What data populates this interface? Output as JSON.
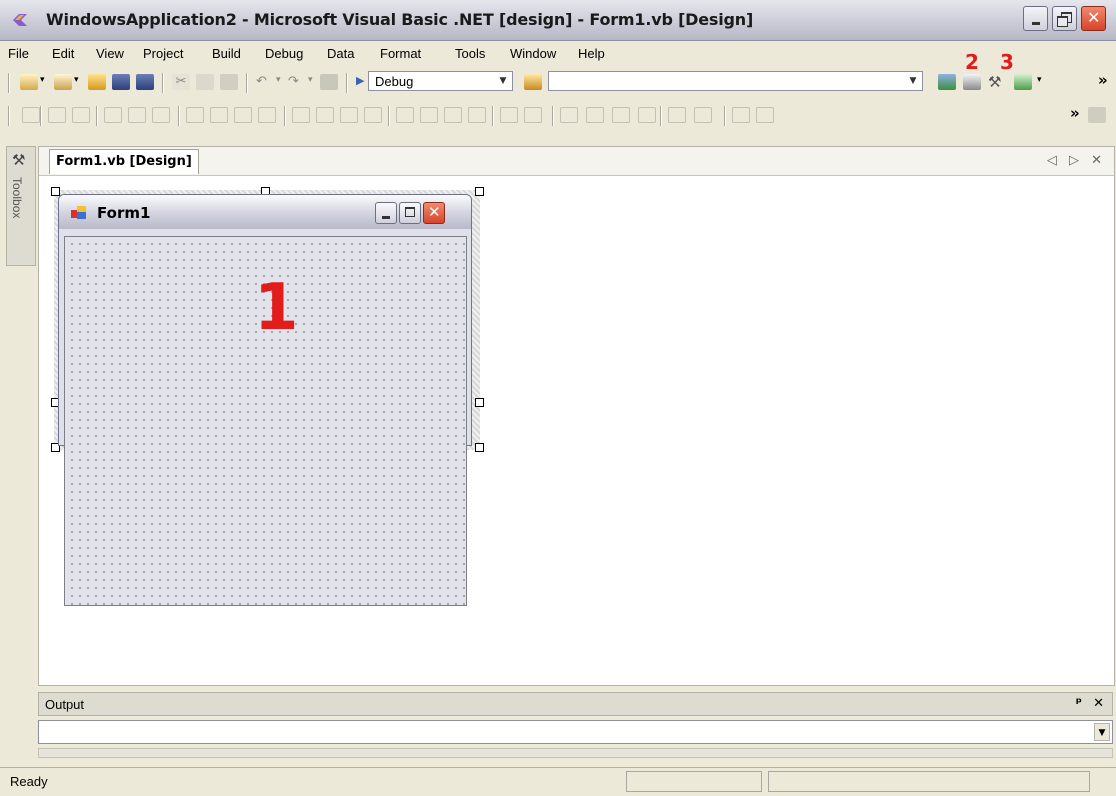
{
  "window": {
    "title": "WindowsApplication2 - Microsoft Visual Basic .NET [design] - Form1.vb [Design]"
  },
  "menu": {
    "items": [
      "File",
      "Edit",
      "View",
      "Project",
      "Build",
      "Debug",
      "Data",
      "Format",
      "Tools",
      "Window",
      "Help"
    ]
  },
  "toolbar": {
    "config_combo": "Debug",
    "overflow_glyph": "»"
  },
  "toolbox": {
    "label": "Toolbox"
  },
  "document": {
    "tab_label": "Form1.vb [Design]",
    "tab_nav": "◁ ▷ ✕"
  },
  "designer": {
    "form_title": "Form1"
  },
  "annotations": {
    "a1": "1",
    "a2": "2",
    "a3": "3"
  },
  "output": {
    "title": "Output",
    "pin": "ᵖ",
    "close": "✕",
    "dropdown": "▼"
  },
  "status": {
    "text": "Ready"
  },
  "colors": {
    "annotation_red": "#e21b1b",
    "close_red": "#d9432a"
  },
  "icons": [
    "app-icon",
    "new-project-icon",
    "add-item-icon",
    "open-icon",
    "save-icon",
    "save-all-icon",
    "cut-icon",
    "copy-icon",
    "paste-icon",
    "undo-icon",
    "redo-icon",
    "navigate-icon",
    "start-icon",
    "find-icon",
    "solution-explorer-icon",
    "properties-icon",
    "toolbox-icon",
    "class-view-icon"
  ]
}
